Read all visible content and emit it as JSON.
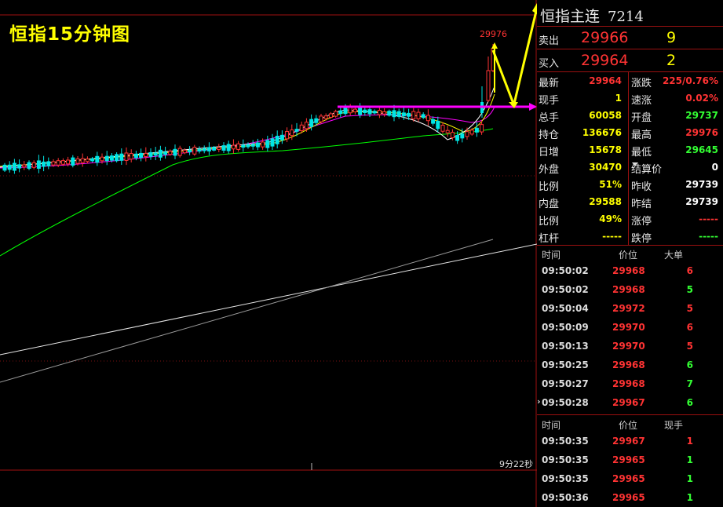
{
  "chart": {
    "title": "恒指15分钟图",
    "high_label": "29976",
    "timer": "9分22秒",
    "colors": {
      "up": "#ff3333",
      "down": "#00e5e5",
      "ma5": "#ffffff",
      "ma10": "#ffff00",
      "ma20": "#ff00ff",
      "ma60": "#00ff00",
      "arrow": "#ffff00",
      "support": "#ff00ff"
    }
  },
  "panel": {
    "title": "恒指主连",
    "code": "7214",
    "sell": {
      "label": "卖出",
      "price": "29966",
      "volume": "9"
    },
    "buy": {
      "label": "买入",
      "price": "29964",
      "volume": "2"
    },
    "stats_left": [
      {
        "label": "最新",
        "value": "29964",
        "color": "#ff3333"
      },
      {
        "label": "现手",
        "value": "1",
        "color": "#ffff00"
      },
      {
        "label": "总手",
        "value": "60058",
        "color": "#ffff00"
      },
      {
        "label": "持仓",
        "value": "136676",
        "color": "#ffff00"
      },
      {
        "label": "日增",
        "value": "15678",
        "color": "#ffff00"
      },
      {
        "label": "外盘",
        "value": "30470",
        "color": "#ffff00"
      },
      {
        "label": "比例",
        "value": "51%",
        "color": "#ffff00"
      },
      {
        "label": "内盘",
        "value": "29588",
        "color": "#ffff00"
      },
      {
        "label": "比例",
        "value": "49%",
        "color": "#ffff00"
      },
      {
        "label": "杠杆",
        "value": "-----",
        "color": "#ffff00"
      }
    ],
    "stats_right": [
      {
        "label": "涨跌",
        "value": "225/0.76%",
        "color": "#ff3333"
      },
      {
        "label": "速涨",
        "value": "0.02%",
        "color": "#ff3333"
      },
      {
        "label": "开盘",
        "value": "29737",
        "color": "#33ff33"
      },
      {
        "label": "最高",
        "value": "29976",
        "color": "#ff3333"
      },
      {
        "label": "最低",
        "value": "29645",
        "color": "#33ff33"
      },
      {
        "label": "结算价",
        "value": "0",
        "color": "#ffffff"
      },
      {
        "label": "昨收",
        "value": "29739",
        "color": "#ffffff"
      },
      {
        "label": "昨结",
        "value": "29739",
        "color": "#ffffff"
      },
      {
        "label": "涨停",
        "value": "-----",
        "color": "#ff3333"
      },
      {
        "label": "跌停",
        "value": "-----",
        "color": "#33ff33"
      }
    ],
    "trades1": {
      "headers": [
        "时间",
        "价位",
        "大单"
      ],
      "rows": [
        {
          "time": "09:50:02",
          "price": "29968",
          "vol": "6",
          "color": "#ff3333"
        },
        {
          "time": "09:50:02",
          "price": "29968",
          "vol": "5",
          "color": "#33ff33"
        },
        {
          "time": "09:50:04",
          "price": "29972",
          "vol": "5",
          "color": "#ff3333"
        },
        {
          "time": "09:50:09",
          "price": "29970",
          "vol": "6",
          "color": "#ff3333"
        },
        {
          "time": "09:50:13",
          "price": "29970",
          "vol": "5",
          "color": "#ff3333"
        },
        {
          "time": "09:50:25",
          "price": "29968",
          "vol": "6",
          "color": "#33ff33"
        },
        {
          "time": "09:50:27",
          "price": "29968",
          "vol": "7",
          "color": "#33ff33"
        },
        {
          "time": "09:50:28",
          "price": "29967",
          "vol": "6",
          "color": "#33ff33"
        }
      ]
    },
    "trades2": {
      "headers": [
        "时间",
        "价位",
        "现手"
      ],
      "rows": [
        {
          "time": "09:50:35",
          "price": "29967",
          "vol": "1",
          "color": "#ff3333"
        },
        {
          "time": "09:50:35",
          "price": "29965",
          "vol": "1",
          "color": "#33ff33"
        },
        {
          "time": "09:50:35",
          "price": "29965",
          "vol": "1",
          "color": "#33ff33"
        },
        {
          "time": "09:50:36",
          "price": "29965",
          "vol": "1",
          "color": "#33ff33"
        }
      ]
    }
  }
}
